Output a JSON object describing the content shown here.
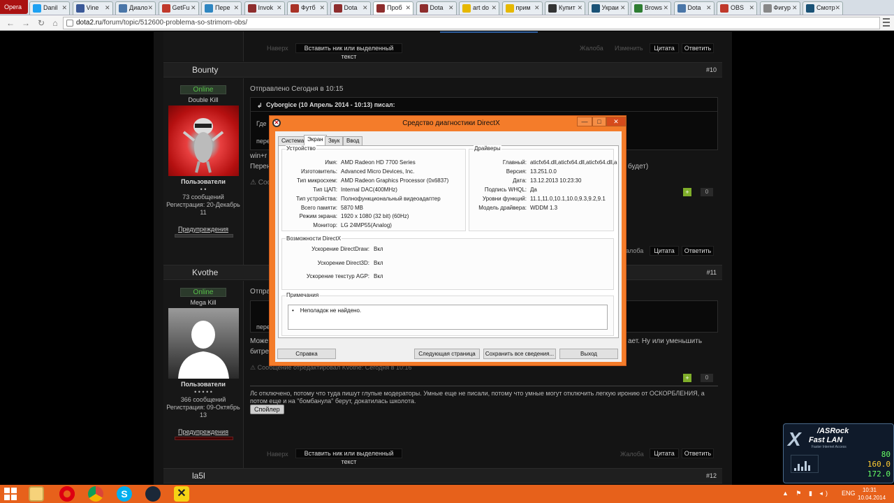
{
  "browser": {
    "menu_label": "Opera",
    "tabs": [
      {
        "label": "Danil",
        "color": "#1da1f2"
      },
      {
        "label": "Vine",
        "color": "#3b5998"
      },
      {
        "label": "Диало",
        "color": "#4a76a8"
      },
      {
        "label": "GetFu",
        "color": "#c0392b"
      },
      {
        "label": "Пере",
        "color": "#2e86c1"
      },
      {
        "label": "Invok",
        "color": "#8e2d2d"
      },
      {
        "label": "Футб",
        "color": "#a93226"
      },
      {
        "label": "Dota",
        "color": "#8e2d2d"
      },
      {
        "label": "Проб",
        "color": "#8e2d2d",
        "active": true
      },
      {
        "label": "Dota",
        "color": "#8e2d2d"
      },
      {
        "label": "art do",
        "color": "#e6b800"
      },
      {
        "label": "прим",
        "color": "#e6b800"
      },
      {
        "label": "Купит",
        "color": "#333333"
      },
      {
        "label": "Украи",
        "color": "#1a5276"
      },
      {
        "label": "Brows",
        "color": "#2e7d32"
      },
      {
        "label": "Dota",
        "color": "#4a76a8"
      },
      {
        "label": "OBS",
        "color": "#c0392b"
      },
      {
        "label": "Фигур",
        "color": "#888888"
      },
      {
        "label": "Смотр",
        "color": "#1a5276"
      }
    ],
    "url_domain": "dota2.ru",
    "url_path": "/forum/topic/512600-problema-so-strimom-obs/"
  },
  "forum": {
    "top_bar": {
      "faint_left": "Наверх",
      "insert_button": "Вставить ник или выделенный текст",
      "faint_report": "Жалоба",
      "faint_edit": "Изменить",
      "quote_button": "Цитата",
      "reply_button": "Ответить"
    },
    "posts": [
      {
        "username": "Bounty",
        "number": "#10",
        "status": "Online",
        "rank": "Double Kill",
        "group": "Пользователи",
        "stars": "• •",
        "messages": "73 сообщений",
        "registration": "Регистрация: 20-Декабрь",
        "registration_day": "11",
        "warnings_label": "Предупреждения",
        "sent": "Отправлено Сегодня в 10:15",
        "quote_author": "Cyborgice (10 Апрель 2014 - 10:13) писал:",
        "quote_line1": "Где",
        "quote_line2": "пере",
        "body_line1": "win+r",
        "body_line2": "Перен",
        "body_line2_tail": "будет)",
        "edited": "Сос",
        "plus": "+",
        "rating": "0",
        "faint_report": "алоба",
        "quote_button": "Цитата",
        "reply_button": "Ответить"
      },
      {
        "username": "Kvothe",
        "number": "#11",
        "status": "Online",
        "rank": "Mega Kill",
        "group": "Пользователи",
        "stars": "• • • • •",
        "messages": "366 сообщений",
        "registration": "Регистрация: 09-Октябрь",
        "registration_day": "13",
        "warnings_label": "Предупреждения",
        "sent": "Отпра",
        "quote_line": "пере",
        "body_line1": "Може",
        "body_line1_tail": "ает. Ну или уменьшить",
        "body_line2": "битре",
        "edited": "Сообщение отредактировал Kvothe: Сегодня в 10:16",
        "plus": "+",
        "rating": "0",
        "signature": "Лс отключено, потому что туда пишут глупые модераторы. Умные еще не писали, потому что умные могут отключить легкую иронию от ОСКОРБЛЕНИЯ, а потом еще и на \"бомбанула\" берут, докатилась школота.",
        "spoiler": "Спойлер",
        "faint_left": "Наверх",
        "insert_button": "Вставить ник или выделенный текст",
        "faint_report": "Жалоба",
        "quote_button": "Цитата",
        "reply_button": "Ответить"
      },
      {
        "username": "la5l",
        "number": "#12"
      }
    ]
  },
  "directx": {
    "title": "Средство диагностики DirectX",
    "min": "—",
    "max": "□",
    "close": "✕",
    "tabs": [
      "Система",
      "Экран",
      "Звук",
      "Ввод"
    ],
    "device_group": "Устройство",
    "device": [
      {
        "k": "Имя:",
        "v": "AMD Radeon HD 7700 Series"
      },
      {
        "k": "Изготовитель:",
        "v": "Advanced Micro Devices, Inc."
      },
      {
        "k": "Тип микросхем:",
        "v": "AMD Radeon Graphics Processor (0x6837)"
      },
      {
        "k": "Тип ЦАП:",
        "v": "Internal DAC(400MHz)"
      },
      {
        "k": "Тип устройства:",
        "v": "Полнофункциональный видеоадаптер"
      },
      {
        "k": "Всего памяти:",
        "v": "5870 MB"
      },
      {
        "k": "Режим экрана:",
        "v": "1920 x 1080 (32 bit) (60Hz)"
      },
      {
        "k": "Монитор:",
        "v": "LG 24MP55(Analog)"
      }
    ],
    "drivers_group": "Драйверы",
    "drivers": [
      {
        "k": "Главный:",
        "v": "aticfx64.dll,aticfx64.dll,aticfx64.dll,a"
      },
      {
        "k": "Версия:",
        "v": "13.251.0.0"
      },
      {
        "k": "Дата:",
        "v": "13.12.2013 10:23:30"
      },
      {
        "k": "Подпись WHQL:",
        "v": "Да"
      },
      {
        "k": "Уровни функций:",
        "v": "11.1,11.0,10.1,10.0,9.3,9.2,9.1"
      },
      {
        "k": "Модель драйвера:",
        "v": "WDDM 1.3"
      }
    ],
    "features_group": "Возможности DirectX",
    "features": [
      {
        "k": "Ускорение DirectDraw:",
        "v": "Вкл"
      },
      {
        "k": "Ускорение Direct3D:",
        "v": "Вкл"
      },
      {
        "k": "Ускорение текстур AGP:",
        "v": "Вкл"
      }
    ],
    "notes_group": "Примечания",
    "note": "Неполадок не найдено.",
    "btn_help": "Справка",
    "btn_next": "Следующая страница",
    "btn_save": "Сохранить все сведения...",
    "btn_exit": "Выход"
  },
  "asrock": {
    "brand": "/ASRock",
    "x": "X",
    "title": "Fast LAN",
    "subtitle": "Faster Internet Access",
    "val1": "80",
    "val2": "160.0",
    "val3": "172.0"
  },
  "taskbar": {
    "sys_icons": "▲ ⚑ ▮ ◂)",
    "lang": "ENG",
    "time": "10:31",
    "date": "10.04.2014"
  }
}
